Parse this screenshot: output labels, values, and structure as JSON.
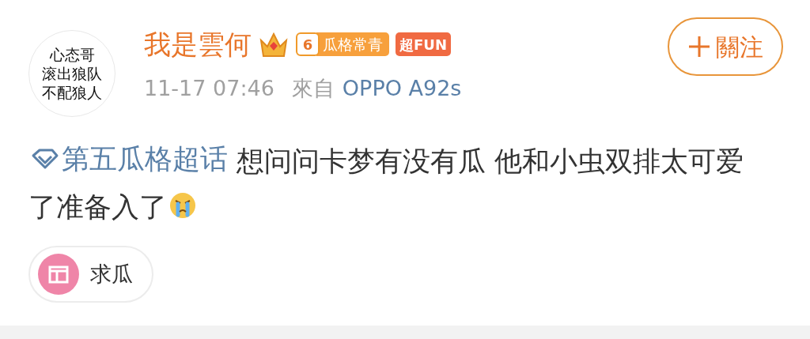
{
  "avatar": {
    "lines": [
      "心态哥",
      "滚出狼队",
      "不配狼人"
    ]
  },
  "user": {
    "name": "我是雲何",
    "level": "6",
    "badge": "瓜格常青",
    "tag": "超FUN"
  },
  "meta": {
    "time": "11-17 07:46",
    "from": "來自",
    "device": "OPPO A92s"
  },
  "follow": {
    "label": "關注"
  },
  "post": {
    "topic": "第五瓜格超话",
    "text": " 想问问卡梦有没有瓜 他和小虫双排太可爱了准备入了"
  },
  "chips": [
    {
      "label": "求瓜"
    }
  ]
}
